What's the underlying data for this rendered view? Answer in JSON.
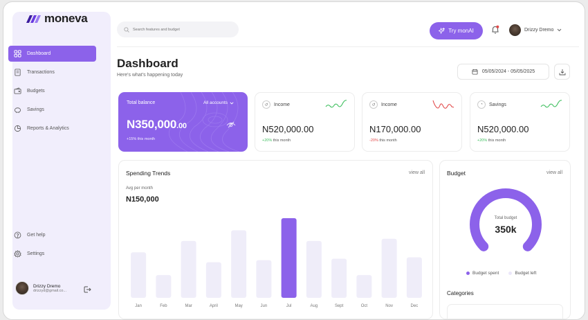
{
  "brand": {
    "name": "moneva",
    "accent": "#8c62ea"
  },
  "sidebar": {
    "items": [
      {
        "label": "Dashboard",
        "icon": "grid-icon",
        "active": true
      },
      {
        "label": "Transactions",
        "icon": "receipt-icon",
        "active": false
      },
      {
        "label": "Budgets",
        "icon": "wallet-icon",
        "active": false
      },
      {
        "label": "Savings",
        "icon": "piggy-bank-icon",
        "active": false
      },
      {
        "label": "Reports & Analytics",
        "icon": "pie-chart-icon",
        "active": false
      }
    ],
    "bottom": [
      {
        "label": "Get help",
        "icon": "help-icon"
      },
      {
        "label": "Settings",
        "icon": "gear-icon"
      }
    ],
    "user": {
      "name": "Drizzy Dremo",
      "email": "drizzyd@gmail.co..."
    }
  },
  "header": {
    "search_placeholder": "Search features and budget",
    "try_label": "Try monAI",
    "user_name": "Drizzy Dremo"
  },
  "page": {
    "title": "Dashboard",
    "subtitle": "Here's what's happening today",
    "date_range": "05/05/2024 - 05/05/2025"
  },
  "balance": {
    "label": "Total balance",
    "accounts": "All accounts",
    "amount_main": "N350,000",
    "amount_dec": ".00",
    "change": "+15% this month"
  },
  "stats": [
    {
      "label": "Income",
      "amount": "N520,000.00",
      "change_value": "+20%",
      "change_text": " this  month",
      "trend": "up",
      "color": "#3fbf5f"
    },
    {
      "label": "Income",
      "amount": "N170,000.00",
      "change_value": "-20%",
      "change_text": " this  month",
      "trend": "down",
      "color": "#e24a4a"
    },
    {
      "label": "Savings",
      "amount": "N520,000.00",
      "change_value": "+20%",
      "change_text": " this  month",
      "trend": "up",
      "color": "#3fbf5f"
    }
  ],
  "trends": {
    "title": "Spending Trends",
    "view_all": "view all",
    "avg_label": "Avg per month",
    "avg_value": "N150,000"
  },
  "chart_data": {
    "type": "bar",
    "categories": [
      "Jan",
      "Feb",
      "Mar",
      "April",
      "May",
      "Jun",
      "Jul",
      "Aug",
      "Sept",
      "Oct",
      "Nov",
      "Dec"
    ],
    "values": [
      64,
      32,
      80,
      50,
      95,
      53,
      112,
      80,
      55,
      32,
      83,
      57
    ],
    "highlight_index": 6,
    "bar_color": "#efedf9",
    "highlight_color": "#8c62ea"
  },
  "budget": {
    "title": "Budget",
    "view_all": "view all",
    "center_label": "Total budget",
    "center_value": "350k",
    "spent_fraction": 1.0,
    "legend": [
      {
        "label": "Budget spent",
        "color": "#8c62ea"
      },
      {
        "label": "Budget left",
        "color": "#ebe7fa"
      }
    ],
    "categories_title": "Categories"
  }
}
